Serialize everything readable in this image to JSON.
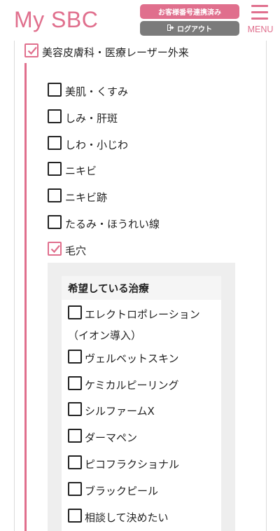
{
  "header": {
    "logo": "My SBC",
    "customer_link_label": "お客様番号連携済み",
    "logout_label": "ログアウト",
    "menu_label": "MENU"
  },
  "colors": {
    "accent": "#e06f8d",
    "gray_button": "#7b7b7b"
  },
  "category": {
    "label": "美容皮膚科・医療レーザー外来",
    "checked": true
  },
  "concerns": [
    {
      "label": "美肌・くすみ",
      "checked": false
    },
    {
      "label": "しみ・肝斑",
      "checked": false
    },
    {
      "label": "しわ・小じわ",
      "checked": false
    },
    {
      "label": "ニキビ",
      "checked": false
    },
    {
      "label": "ニキビ跡",
      "checked": false
    },
    {
      "label": "たるみ・ほうれい線",
      "checked": false
    },
    {
      "label": "毛穴",
      "checked": true
    }
  ],
  "treatments": {
    "title": "希望している治療",
    "items": [
      {
        "label": "エレクトロポレーション",
        "label_line2": "（イオン導入）",
        "checked": false
      },
      {
        "label": "ヴェルベットスキン",
        "checked": false
      },
      {
        "label": "ケミカルピーリング",
        "checked": false
      },
      {
        "label": "シルファームX",
        "checked": false
      },
      {
        "label": "ダーマペン",
        "checked": false
      },
      {
        "label": "ピコフラクショナル",
        "checked": false
      },
      {
        "label": "ブラックピール",
        "checked": false
      },
      {
        "label": "相談して決めたい",
        "checked": false
      }
    ]
  }
}
